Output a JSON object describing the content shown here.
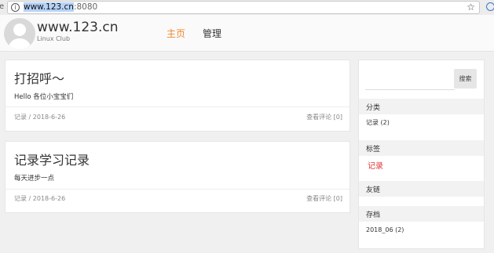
{
  "browser": {
    "url_host": "www.123.cn",
    "url_port": ":8080",
    "edge_char": "e"
  },
  "site": {
    "title": "www.123.cn",
    "subtitle": "Linux Club",
    "nav": {
      "home": "主页",
      "admin": "管理"
    },
    "accent_color": "#f0872a"
  },
  "posts": [
    {
      "title": "打招呼～",
      "body": "Hello 各位小宝宝们",
      "meta": "记录 / 2018-6-26",
      "comments_link": "查看评论 [0]"
    },
    {
      "title": "记录学习记录",
      "body": "每天进步一点",
      "meta": "记录 / 2018-6-26",
      "comments_link": "查看评论 [0]"
    }
  ],
  "sidebar": {
    "search_button": "搜索",
    "search_value": "",
    "categories": {
      "heading": "分类",
      "items": [
        "记录 (2)"
      ]
    },
    "tags": {
      "heading": "标签",
      "items": [
        "记录"
      ],
      "color": "#e03a3a"
    },
    "links": {
      "heading": "友链"
    },
    "archive": {
      "heading": "存档",
      "items": [
        "2018_06 (2)"
      ]
    }
  }
}
